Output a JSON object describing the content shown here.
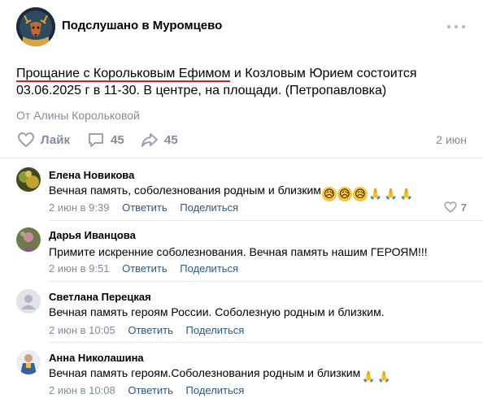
{
  "header": {
    "group_name": "Подслушано в Муромцево",
    "avatar_icon": "deer-avatar-icon",
    "more_icon": "more-dots-icon"
  },
  "post": {
    "text_highlighted": "Прощание с Корольковым Ефимом",
    "text_rest": " и Козловым Юрием состоится 03.06.2025 г в 11-30. В центре, на площади. (Петропавловка)",
    "author": "От Алины Корольковой",
    "date": "2 июн",
    "like_label": "Лайк",
    "comments_count": "45",
    "shares_count": "45",
    "highlight_color": "#d91e1e"
  },
  "comments": [
    {
      "name": "Елена Новикова",
      "text": "Вечная память, соболезнования родным и близким",
      "emojis": [
        "😥",
        "😥",
        "😥",
        "🙏",
        "🙏",
        "🙏"
      ],
      "time": "2 июн в 9:39",
      "reply": "Ответить",
      "share": "Поделиться",
      "likes": "7"
    },
    {
      "name": "Дарья Иванцова",
      "text": "Примите искренние соболезнования. Вечная память нашим ГЕРОЯМ!!!",
      "emojis": [],
      "time": "2 июн в 9:51",
      "reply": "Ответить",
      "share": "Поделиться",
      "likes": ""
    },
    {
      "name": "Светлана Перецкая",
      "text": "Вечная память героям России. Соболезную родным и близким.",
      "emojis": [],
      "time": "2 июн в 10:05",
      "reply": "Ответить",
      "share": "Поделиться",
      "likes": ""
    },
    {
      "name": "Анна Николашина",
      "text": "Вечная память героям.Соболезнования родным и близким",
      "emojis": [
        "🙏",
        "🙏"
      ],
      "time": "2 июн в 10:08",
      "reply": "Ответить",
      "share": "Поделиться",
      "likes": ""
    }
  ],
  "colors": {
    "link": "#2a5885",
    "muted": "#818c99",
    "divider": "#e7e8ec"
  }
}
